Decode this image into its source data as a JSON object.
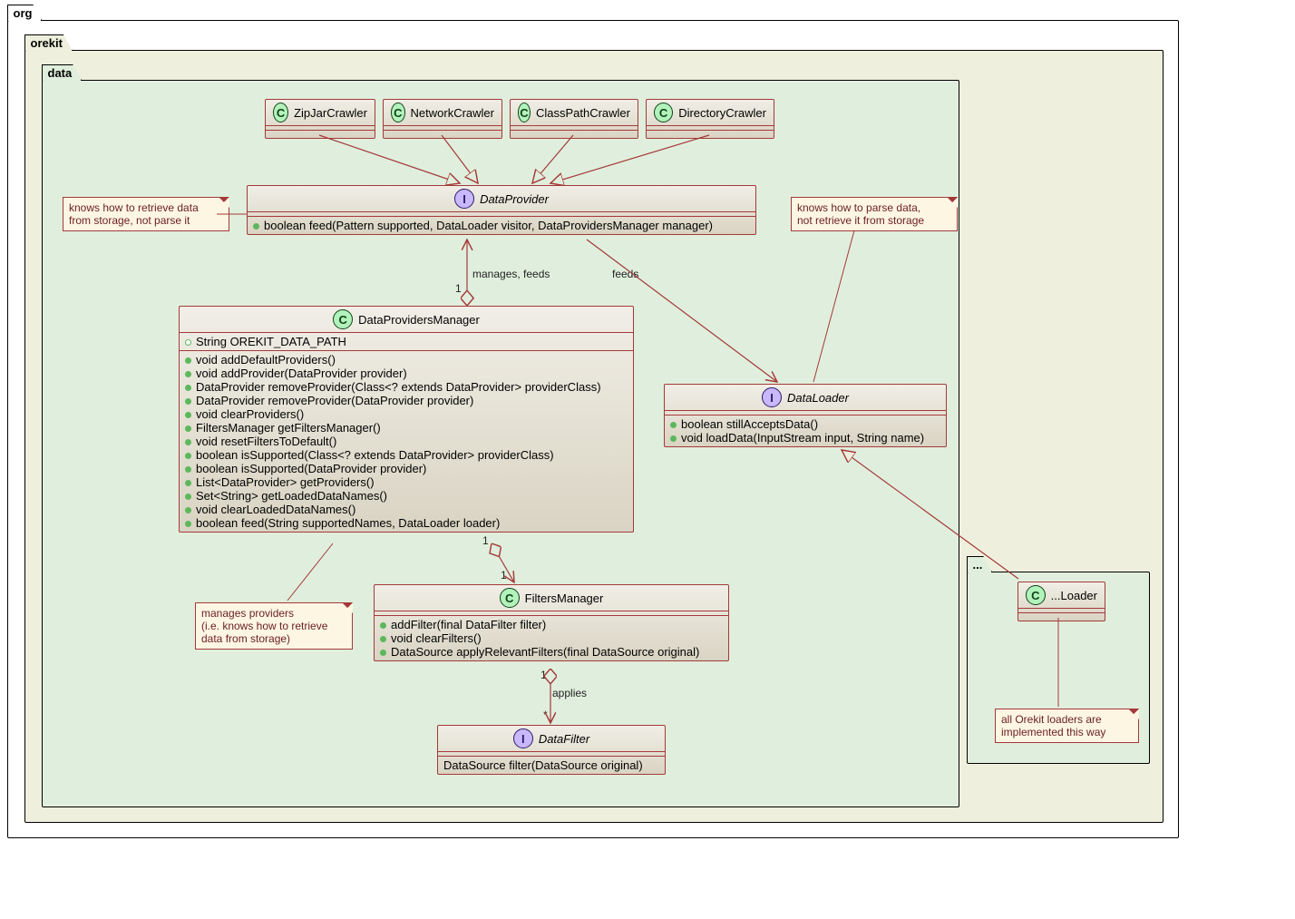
{
  "packages": {
    "org": "org",
    "orekit": "orekit",
    "data": "data",
    "anon": "..."
  },
  "classes": {
    "zipjar": {
      "name": "ZipJarCrawler",
      "spot": "C"
    },
    "network": {
      "name": "NetworkCrawler",
      "spot": "C"
    },
    "classpath": {
      "name": "ClassPathCrawler",
      "spot": "C"
    },
    "directory": {
      "name": "DirectoryCrawler",
      "spot": "C"
    },
    "dataprovider": {
      "name": "DataProvider",
      "spot": "I",
      "members": [
        "boolean feed(Pattern supported, DataLoader visitor, DataProvidersManager manager)"
      ]
    },
    "dpm": {
      "name": "DataProvidersManager",
      "spot": "C",
      "statics": [
        "String OREKIT_DATA_PATH"
      ],
      "members": [
        "void addDefaultProviders()",
        "void addProvider(DataProvider provider)",
        "DataProvider removeProvider(Class<? extends DataProvider> providerClass)",
        "DataProvider removeProvider(DataProvider provider)",
        "void clearProviders()",
        "FiltersManager getFiltersManager()",
        "void resetFiltersToDefault()",
        "boolean isSupported(Class<? extends DataProvider> providerClass)",
        "boolean isSupported(DataProvider provider)",
        "List<DataProvider> getProviders()",
        "Set<String> getLoadedDataNames()",
        "void clearLoadedDataNames()",
        "boolean feed(String supportedNames, DataLoader loader)"
      ]
    },
    "dataloader": {
      "name": "DataLoader",
      "spot": "I",
      "members": [
        "boolean stillAcceptsData()",
        "void loadData(InputStream input, String name)"
      ]
    },
    "filtersmgr": {
      "name": "FiltersManager",
      "spot": "C",
      "members": [
        "addFilter(final DataFilter filter)",
        "void clearFilters()",
        "DataSource applyRelevantFilters(final DataSource original)"
      ]
    },
    "datafilter": {
      "name": "DataFilter",
      "spot": "I",
      "members": [
        "DataSource filter(DataSource original)"
      ]
    },
    "anyloader": {
      "name": "...Loader",
      "spot": "C"
    }
  },
  "notes": {
    "dp_note": "knows how to retrieve data\nfrom storage, not parse it",
    "dl_note": "knows how to parse data,\nnot retrieve it from storage",
    "dpm_note": "manages providers\n(i.e. knows how to retrieve\ndata from storage)",
    "loader_note": "all Orekit loaders are\nimplemented this way"
  },
  "labels": {
    "manages_feeds": "manages, feeds",
    "feeds": "feeds",
    "applies": "applies",
    "one": "1",
    "many": "*"
  },
  "chart_data": {
    "type": "diagram",
    "diagram_type": "uml_class",
    "packages": [
      "org",
      "org.orekit",
      "org.orekit.data",
      "..."
    ],
    "entities": [
      {
        "name": "ZipJarCrawler",
        "type": "class",
        "package": "org.orekit.data"
      },
      {
        "name": "NetworkCrawler",
        "type": "class",
        "package": "org.orekit.data"
      },
      {
        "name": "ClassPathCrawler",
        "type": "class",
        "package": "org.orekit.data"
      },
      {
        "name": "DirectoryCrawler",
        "type": "class",
        "package": "org.orekit.data"
      },
      {
        "name": "DataProvider",
        "type": "interface",
        "package": "org.orekit.data"
      },
      {
        "name": "DataProvidersManager",
        "type": "class",
        "package": "org.orekit.data"
      },
      {
        "name": "DataLoader",
        "type": "interface",
        "package": "org.orekit.data"
      },
      {
        "name": "FiltersManager",
        "type": "class",
        "package": "org.orekit.data"
      },
      {
        "name": "DataFilter",
        "type": "interface",
        "package": "org.orekit.data"
      },
      {
        "name": "...Loader",
        "type": "class",
        "package": "..."
      }
    ],
    "relations": [
      {
        "from": "ZipJarCrawler",
        "to": "DataProvider",
        "type": "realization"
      },
      {
        "from": "NetworkCrawler",
        "to": "DataProvider",
        "type": "realization"
      },
      {
        "from": "ClassPathCrawler",
        "to": "DataProvider",
        "type": "realization"
      },
      {
        "from": "DirectoryCrawler",
        "to": "DataProvider",
        "type": "realization"
      },
      {
        "from": "DataProvidersManager",
        "to": "DataProvider",
        "type": "aggregation",
        "label": "manages, feeds",
        "from_mult": "1",
        "to_mult": "1"
      },
      {
        "from": "DataProvider",
        "to": "DataLoader",
        "type": "association",
        "label": "feeds"
      },
      {
        "from": "DataProvidersManager",
        "to": "FiltersManager",
        "type": "aggregation",
        "from_mult": "1",
        "to_mult": "1"
      },
      {
        "from": "FiltersManager",
        "to": "DataFilter",
        "type": "aggregation",
        "label": "applies",
        "from_mult": "1",
        "to_mult": "*"
      },
      {
        "from": "...Loader",
        "to": "DataLoader",
        "type": "realization"
      }
    ]
  }
}
